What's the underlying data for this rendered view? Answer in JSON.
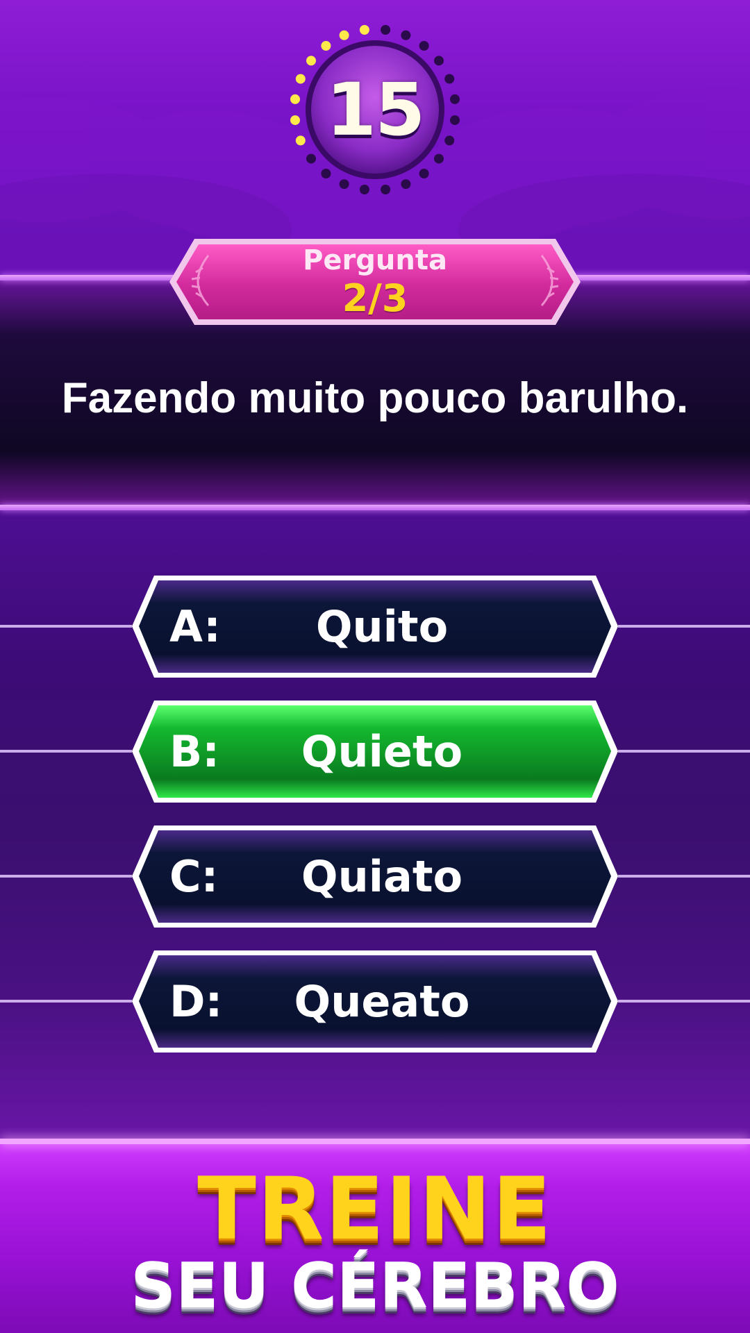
{
  "timer": {
    "value": "15",
    "total_dots": 24,
    "lit_dots": 8
  },
  "question": {
    "label": "Pergunta",
    "counter": "2/3",
    "text": "Fazendo muito pouco barulho."
  },
  "answers": [
    {
      "letter": "A:",
      "text": "Quito",
      "state": "normal"
    },
    {
      "letter": "B:",
      "text": "Quieto",
      "state": "correct"
    },
    {
      "letter": "C:",
      "text": "Quiato",
      "state": "normal"
    },
    {
      "letter": "D:",
      "text": "Queato",
      "state": "normal"
    }
  ],
  "promo": {
    "line1": "TREINE",
    "line2": "SEU CÉREBRO"
  },
  "colors": {
    "correct": "#19d83a",
    "answer_bg": "#0b1436",
    "badge": "#e23ca8",
    "accent_yellow": "#ffd21f"
  }
}
